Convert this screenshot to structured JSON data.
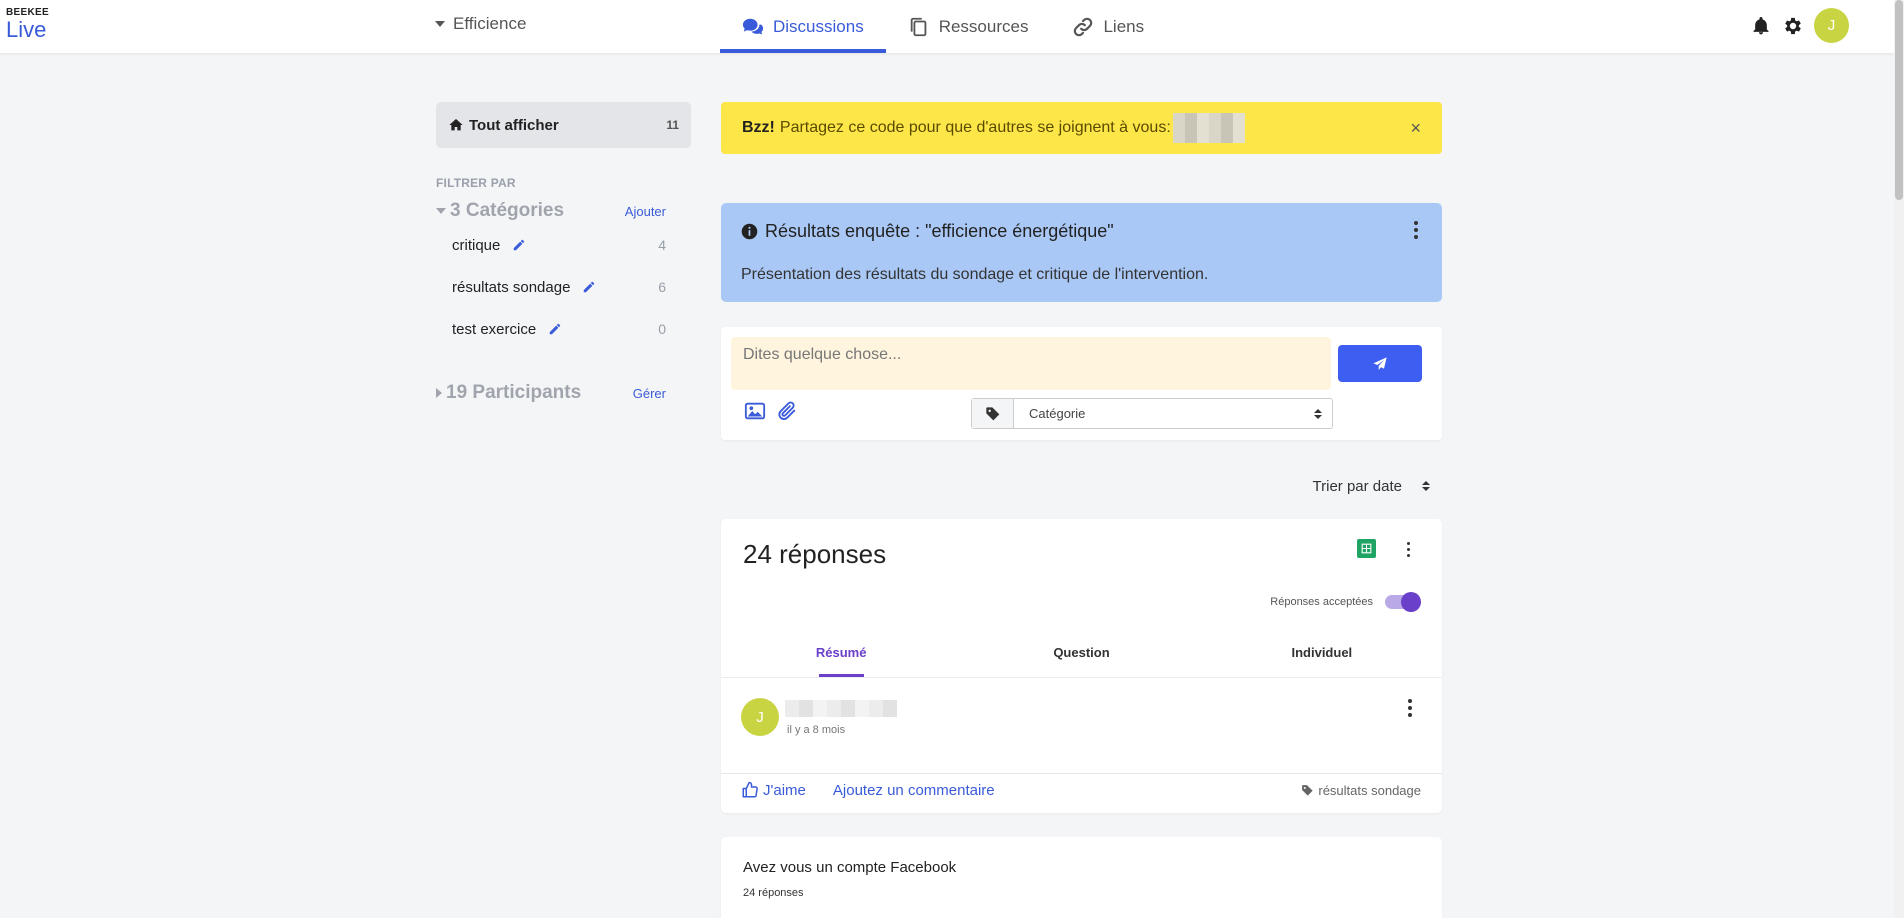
{
  "app": {
    "logo_small": "BEEKEE",
    "logo_big": "Live",
    "group": "Efficience",
    "user_initial": "J"
  },
  "nav": {
    "tabs": [
      {
        "label": "Discussions",
        "icon": "comments-icon",
        "active": true
      },
      {
        "label": "Ressources",
        "icon": "copy-icon",
        "active": false
      },
      {
        "label": "Liens",
        "icon": "link-icon",
        "active": false
      }
    ],
    "icons": [
      "bell-icon",
      "gear-icon"
    ]
  },
  "sidebar": {
    "show_all": {
      "label": "Tout afficher",
      "count": "11"
    },
    "filter_by": "FILTRER PAR",
    "categories": {
      "title": "3 Catégories",
      "action": "Ajouter",
      "items": [
        {
          "label": "critique",
          "count": "4"
        },
        {
          "label": "résultats sondage",
          "count": "6"
        },
        {
          "label": "test exercice",
          "count": "0"
        }
      ]
    },
    "participants": {
      "title": "19 Participants",
      "action": "Gérer"
    }
  },
  "banner": {
    "strong": "Bzz!",
    "text": "Partagez ce code pour que d'autres se joignent à vous:",
    "close": "×",
    "color": "#fde748"
  },
  "info_card": {
    "title": "Résultats enquête : \"efficience énergétique\"",
    "description": "Présentation des résultats du sondage et critique de l'intervention.",
    "color": "#aac8f6"
  },
  "composer": {
    "placeholder": "Dites quelque chose...",
    "category_placeholder": "Catégorie",
    "accent": "#3d5ef0"
  },
  "sort": {
    "label": "Trier par date"
  },
  "poll": {
    "title": "24 réponses",
    "accept_label": "Réponses acceptées",
    "accepting": true,
    "tabs": [
      "Résumé",
      "Question",
      "Individuel"
    ],
    "active_tab": "Résumé",
    "accent": "#6a3fc9"
  },
  "post": {
    "author_initial": "J",
    "time": "il y a 8 mois",
    "like": "J'aime",
    "comment": "Ajoutez un commentaire",
    "tag": "résultats sondage"
  },
  "question": {
    "title": "Avez vous un compte Facebook",
    "count": "24 réponses"
  }
}
